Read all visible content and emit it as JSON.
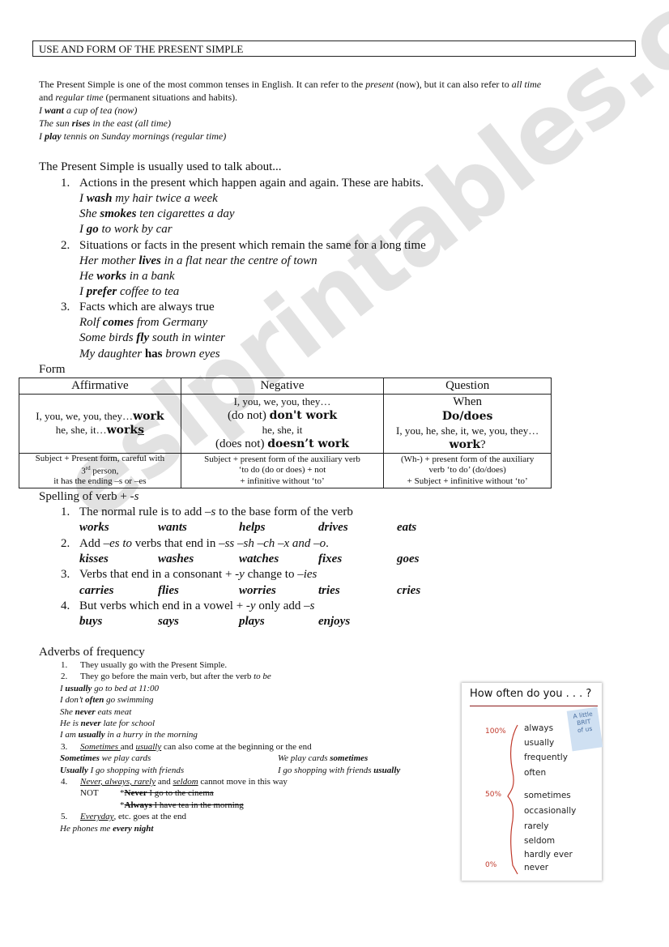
{
  "title": "USE AND FORM OF THE PRESENT SIMPLE",
  "intro": {
    "para": [
      [
        "The Present Simple is one of the most common tenses in English.  It can refer to the ",
        ""
      ],
      [
        "present",
        "i"
      ],
      [
        " (now), but it can also refer to ",
        ""
      ],
      [
        "all time",
        "i"
      ]
    ],
    "para2": [
      [
        "and ",
        ""
      ],
      [
        "regular time",
        "i"
      ],
      [
        " (permanent situations and habits).",
        ""
      ]
    ],
    "examples": [
      [
        [
          "I ",
          "i"
        ],
        [
          "want",
          "bi"
        ],
        [
          " a cup of tea (now)",
          "i"
        ]
      ],
      [
        [
          "The sun ",
          "i"
        ],
        [
          "rises",
          "bi"
        ],
        [
          " in the east (all time)",
          "i"
        ]
      ],
      [
        [
          "I ",
          "i"
        ],
        [
          "play",
          "bi"
        ],
        [
          " tennis on Sunday mornings (regular time)",
          "i"
        ]
      ]
    ]
  },
  "uses": {
    "heading": "The Present Simple is usually used to talk about...",
    "items": [
      {
        "num": "1.",
        "text": "Actions in the present which happen again and again. These are habits.",
        "examples": [
          [
            [
              "I ",
              "i"
            ],
            [
              "wash",
              "bi"
            ],
            [
              " my hair twice a week",
              "i"
            ]
          ],
          [
            [
              "She ",
              "i"
            ],
            [
              "smokes",
              "bi"
            ],
            [
              " ten cigarettes a day",
              "i"
            ]
          ],
          [
            [
              "I ",
              "i"
            ],
            [
              "go",
              "bi"
            ],
            [
              " to work by car",
              "i"
            ]
          ]
        ]
      },
      {
        "num": "2.",
        "text": "Situations or facts in the present which remain the same for a long time",
        "examples": [
          [
            [
              "Her mother ",
              "i"
            ],
            [
              "lives",
              "bi"
            ],
            [
              " in a flat near the centre of town",
              "i"
            ]
          ],
          [
            [
              "He ",
              "i"
            ],
            [
              "works",
              "bi"
            ],
            [
              " in a bank",
              "i"
            ]
          ],
          [
            [
              "I ",
              "i"
            ],
            [
              "prefer",
              "bi"
            ],
            [
              " coffee to tea",
              "i"
            ]
          ]
        ]
      },
      {
        "num": "3.",
        "text": "Facts which are always true",
        "examples": [
          [
            [
              "Rolf ",
              "i"
            ],
            [
              "comes",
              "bi"
            ],
            [
              " from Germany",
              "i"
            ]
          ],
          [
            [
              "Some birds ",
              "i"
            ],
            [
              "fly",
              "bi"
            ],
            [
              " south in winter",
              "i"
            ]
          ],
          [
            [
              "My daughter ",
              "i"
            ],
            [
              "has",
              "b"
            ],
            [
              " brown eyes",
              "i"
            ]
          ]
        ]
      }
    ]
  },
  "form": {
    "heading": "Form",
    "headers": [
      "Affirmative",
      "Negative",
      "Question"
    ],
    "affirmative": {
      "line1": "I, you, we, you, they…",
      "verb1": "work",
      "line2": "he, she, it…",
      "verb2": "work",
      "verb2_suffix": "s"
    },
    "negative": {
      "line1": "I, you, we, you, they…",
      "paren1": "(do not) ",
      "verb1": "don't work",
      "line2": "he, she, it",
      "paren2": "(does not) ",
      "verb2": "doesn’t work"
    },
    "question": {
      "line1": "When",
      "aux": "Do/does",
      "line2": "I, you, he, she, it, we, you, they…",
      "verb": "work",
      "qmark": "?"
    },
    "notes": {
      "affirmative": [
        "Subject + Present form, careful with",
        "3",
        "rd",
        " person,",
        "it has the ending –s or –es"
      ],
      "negative": [
        "Subject + present form of the auxiliary verb",
        "‘to do (do or does) + not",
        "+ infinitive without ‘to’"
      ],
      "question": [
        "(Wh-) + present form of the auxiliary",
        "verb ‘to do’ (do/does)",
        "+ Subject + infinitive without ‘to’"
      ]
    }
  },
  "spelling": {
    "heading": [
      [
        "Spelling of verb + ",
        ""
      ],
      [
        "-s",
        "i"
      ]
    ],
    "rules": [
      {
        "num": "1.",
        "text": [
          [
            "The normal rule is to add ",
            ""
          ],
          [
            "–s",
            "i"
          ],
          [
            " to the base form of the verb",
            ""
          ]
        ],
        "words": [
          "works",
          "wants",
          "helps",
          "drives",
          "eats"
        ]
      },
      {
        "num": "2.",
        "text": [
          [
            "Add ",
            ""
          ],
          [
            "–es to",
            "i"
          ],
          [
            " verbs that end in ",
            ""
          ],
          [
            "–ss –sh –ch –x and  –o",
            "i"
          ],
          [
            ".",
            ""
          ]
        ],
        "words": [
          "kisses",
          "washes",
          "watches",
          "fixes",
          "goes"
        ]
      },
      {
        "num": "3.",
        "text": [
          [
            "Verbs that end in a consonant  + ",
            ""
          ],
          [
            "-y",
            "i"
          ],
          [
            "  change to ",
            ""
          ],
          [
            "–ies",
            "i"
          ]
        ],
        "words": [
          "carries",
          "flies",
          "worries",
          "tries",
          "cries"
        ]
      },
      {
        "num": "4.",
        "text": [
          [
            "But verbs which end in a vowel + ",
            ""
          ],
          [
            "-y",
            "i"
          ],
          [
            " only add ",
            ""
          ],
          [
            "–s",
            "i"
          ]
        ],
        "words": [
          "buys",
          "says",
          "plays",
          "enjoys"
        ]
      }
    ]
  },
  "adverbs": {
    "heading": "Adverbs of frequency",
    "lines": [
      {
        "num": "1.",
        "seg": [
          [
            "They usually go with the Present Simple.",
            ""
          ]
        ]
      },
      {
        "num": "2.",
        "seg": [
          [
            "They go before the main verb, but after the verb ",
            ""
          ],
          [
            "to be",
            "i"
          ]
        ]
      },
      {
        "seg": [
          [
            "I ",
            "i"
          ],
          [
            "usually",
            "bi"
          ],
          [
            " go to bed at 11:00",
            "i"
          ]
        ]
      },
      {
        "seg": [
          [
            "I don’t ",
            "i"
          ],
          [
            "often",
            "bi"
          ],
          [
            " go swimming",
            "i"
          ]
        ]
      },
      {
        "seg": [
          [
            "She ",
            "i"
          ],
          [
            "never",
            "bi"
          ],
          [
            " eats meat",
            "i"
          ]
        ]
      },
      {
        "seg": [
          [
            "He is ",
            "i"
          ],
          [
            "never",
            "bi"
          ],
          [
            " late for school",
            "i"
          ]
        ]
      },
      {
        "seg": [
          [
            "I am ",
            "i"
          ],
          [
            "usually",
            "bi"
          ],
          [
            " in a hurry in the morning",
            "i"
          ]
        ]
      },
      {
        "num": "3.",
        "seg": [
          [
            "Sometimes ",
            "iu"
          ],
          [
            "and ",
            ""
          ],
          [
            "usually",
            "iu"
          ],
          [
            " can also come at the beginning or the end",
            ""
          ]
        ]
      },
      {
        "seg": [
          [
            "Sometimes",
            "bi"
          ],
          [
            " we play cards",
            "i"
          ]
        ],
        "seg2": [
          [
            "We play cards ",
            "i"
          ],
          [
            "sometimes",
            "bi"
          ]
        ]
      },
      {
        "seg": [
          [
            "Usually",
            "bi"
          ],
          [
            " I go shopping with friends",
            "i"
          ]
        ],
        "seg2": [
          [
            "I go shopping with friends ",
            "i"
          ],
          [
            "usually",
            "bi"
          ]
        ]
      },
      {
        "num": "4.",
        "seg": [
          [
            "Never, always, rarely",
            "iu"
          ],
          [
            " and ",
            ""
          ],
          [
            "seldom",
            "iu"
          ],
          [
            " cannot move in this way",
            ""
          ]
        ]
      },
      {
        "lead": "NOT",
        "seg": [
          [
            "*",
            ""
          ],
          [
            "Never",
            "bs"
          ],
          [
            " I go to the cinema",
            "s"
          ]
        ]
      },
      {
        "seg": [
          [
            "*",
            ""
          ],
          [
            "Always",
            "bs"
          ],
          [
            " I have tea in the morning",
            "s"
          ]
        ]
      },
      {
        "num": "5.",
        "seg": [
          [
            "Everyday",
            "iu"
          ],
          [
            ", etc. goes at the end",
            ""
          ]
        ]
      },
      {
        "seg": [
          [
            "He phones me ",
            "i"
          ],
          [
            "every night",
            "bi"
          ]
        ]
      }
    ]
  },
  "frequency_image": {
    "title": "How often do you . . . ?",
    "stamp": [
      "A little",
      "BRIT",
      "of us"
    ],
    "percents": [
      "100%",
      "50%",
      "0%"
    ],
    "words": [
      "always",
      "usually",
      "frequently",
      "often",
      "sometimes",
      "occasionally",
      "rarely",
      "seldom",
      "hardly ever",
      "never"
    ],
    "accent_color": "#c0392b"
  },
  "watermark": "eslprintables.com"
}
